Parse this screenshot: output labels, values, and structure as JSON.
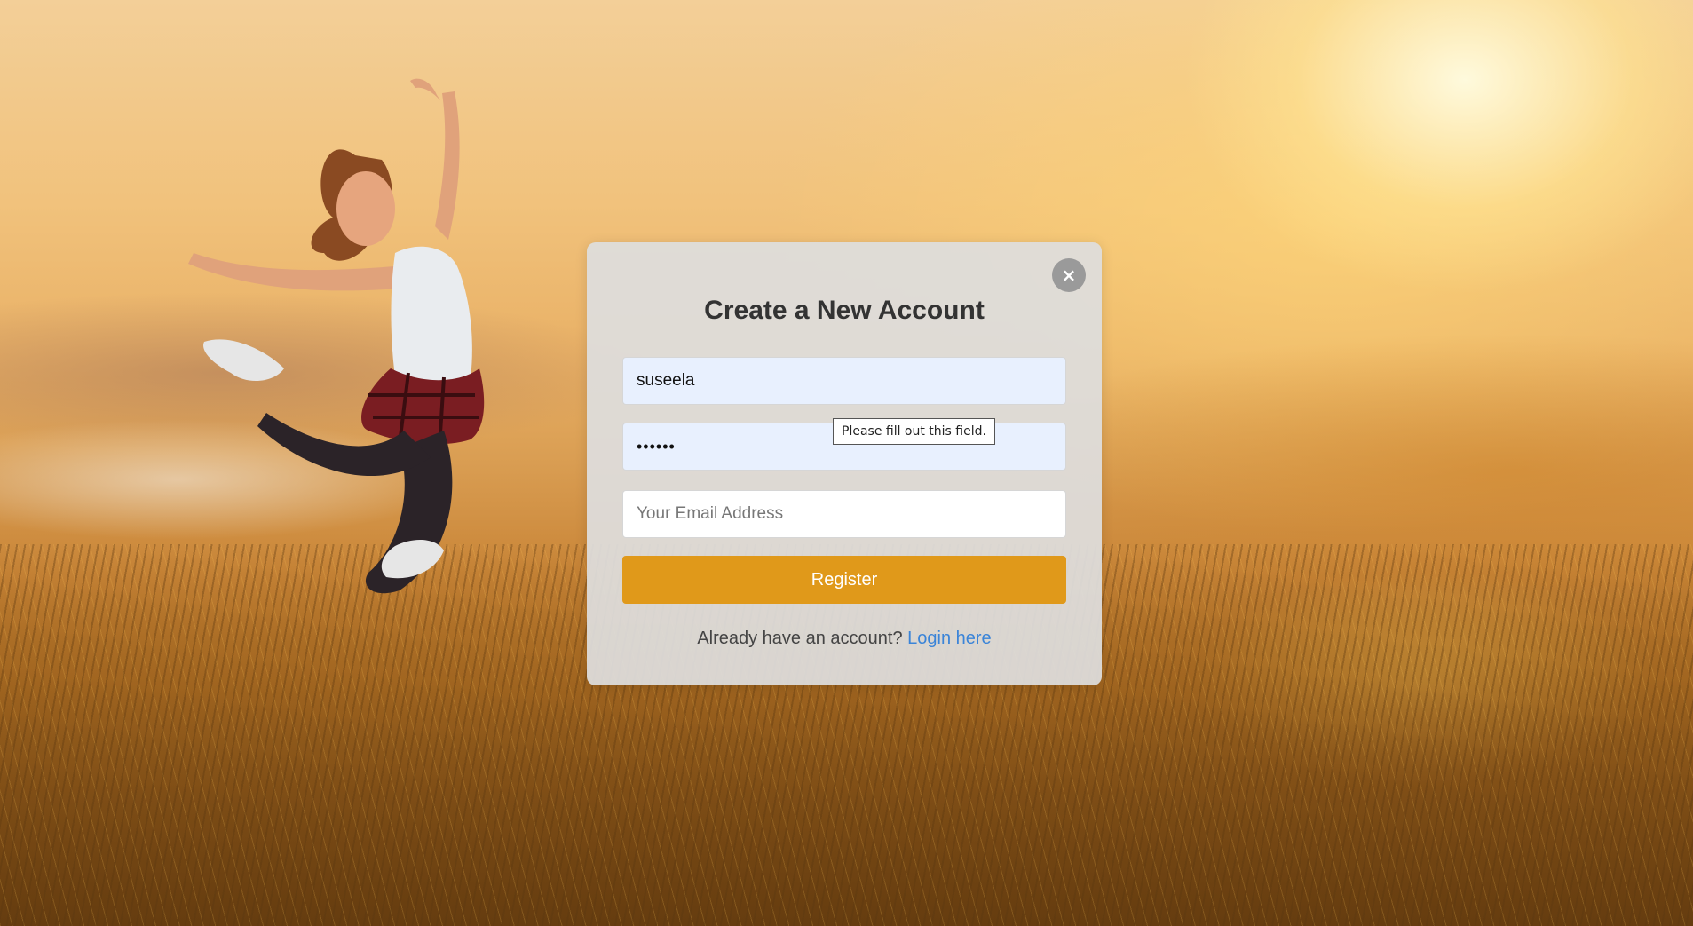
{
  "background": {
    "description_icon": "sunset-field-photo"
  },
  "modal": {
    "close_symbol": "×",
    "title": "Create a New Account",
    "username_value": "suseela",
    "password_value": "••••••",
    "email_placeholder": "Your Email Address",
    "email_value": "",
    "register_label": "Register",
    "login_prompt": "Already have an account?",
    "login_link": "Login here"
  },
  "tooltip": {
    "text": "Please fill out this field."
  },
  "colors": {
    "register_button": "#e0991a",
    "autofill_field": "#e8f0fe",
    "link": "#3a84d8",
    "close_button": "#9a9a9a"
  }
}
